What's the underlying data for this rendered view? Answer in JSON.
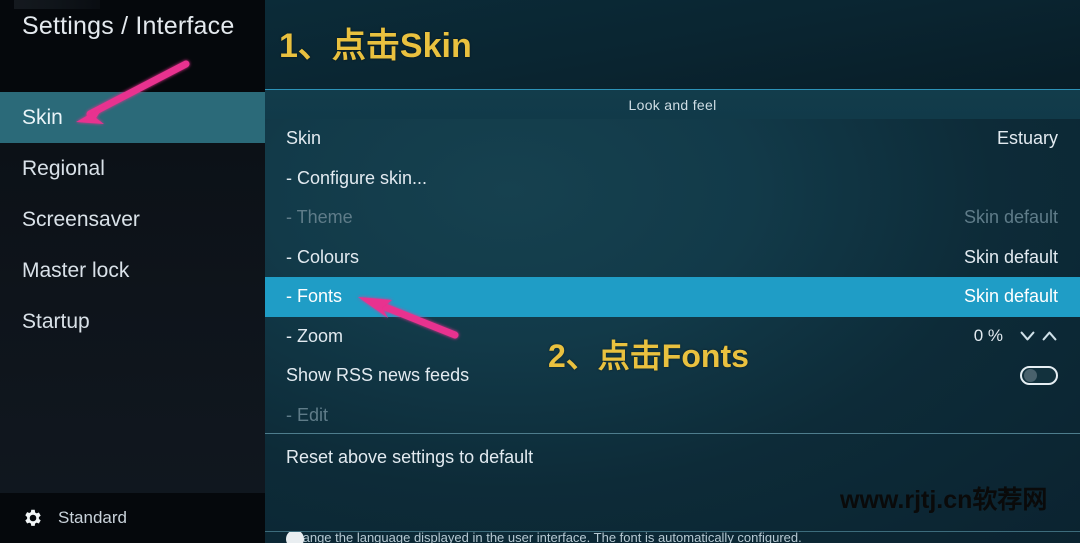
{
  "window": {
    "title": "Settings / Interface"
  },
  "sidebar": {
    "items": [
      {
        "label": "Skin",
        "name": "sidebar-item-skin",
        "selected": true
      },
      {
        "label": "Regional",
        "name": "sidebar-item-regional",
        "selected": false
      },
      {
        "label": "Screensaver",
        "name": "sidebar-item-screensaver",
        "selected": false
      },
      {
        "label": "Master lock",
        "name": "sidebar-item-master-lock",
        "selected": false
      },
      {
        "label": "Startup",
        "name": "sidebar-item-startup",
        "selected": false
      }
    ],
    "footer": {
      "icon": "gear-icon",
      "level_label": "Standard"
    }
  },
  "main": {
    "section_header": "Look and feel",
    "rows": [
      {
        "label": "Skin",
        "value": "Estuary",
        "control": "value",
        "state": "normal"
      },
      {
        "label": "- Configure skin...",
        "value": "",
        "control": "none",
        "state": "normal"
      },
      {
        "label": "- Theme",
        "value": "Skin default",
        "control": "value",
        "state": "disabled"
      },
      {
        "label": "- Colours",
        "value": "Skin default",
        "control": "value",
        "state": "normal"
      },
      {
        "label": "- Fonts",
        "value": "Skin default",
        "control": "value",
        "state": "selected"
      },
      {
        "label": "- Zoom",
        "value": "0 %",
        "control": "spinner",
        "state": "normal"
      },
      {
        "label": "Show RSS news feeds",
        "value": "",
        "control": "toggle",
        "state": "normal",
        "toggle_on": false
      },
      {
        "label": "- Edit",
        "value": "",
        "control": "none",
        "state": "disabled"
      }
    ],
    "reset_row": {
      "label": "Reset above settings to default"
    },
    "help_text": "Change the language displayed in the user interface. The font is automatically configured."
  },
  "annotations": [
    {
      "text": "1、点击Skin",
      "name": "annotation-step-1"
    },
    {
      "text": "2、点击Fonts",
      "name": "annotation-step-2"
    }
  ],
  "watermark": {
    "text": "www.rjtj.cn软荐网"
  },
  "colors": {
    "sidebar_highlight": "#2b6a79",
    "row_selected": "#1f9dc6",
    "annotation": "#e9c13f",
    "arrow": "#e8308f",
    "panel_bg": "#123a49"
  }
}
